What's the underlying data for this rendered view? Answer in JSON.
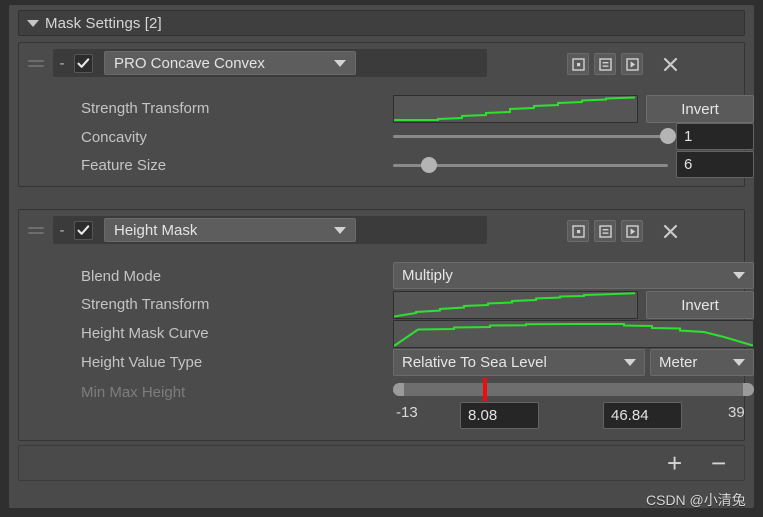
{
  "window": {
    "background": "#2f2f2f"
  },
  "foldout": {
    "title": "Mask Settings [2]",
    "arrow_icon": "triangle-down-icon"
  },
  "colors": {
    "curve_line": "#2ee02e",
    "marker_red": "#f00a0a",
    "panel": "#4b4b4b",
    "field_dark": "#262626",
    "text": "#c4c4c4"
  },
  "modules": [
    {
      "id": "pro-concave-convex",
      "collapse_label": "-",
      "enabled": true,
      "name": "PRO Concave Convex",
      "header_buttons": [
        "preset-icon",
        "list-icon",
        "play-icon"
      ],
      "close_label": "✕",
      "rows": [
        {
          "label": "Strength Transform",
          "type": "curve",
          "action_label": "Invert"
        },
        {
          "label": "Concavity",
          "type": "slider",
          "value": "1",
          "fill": 100
        },
        {
          "label": "Feature Size",
          "type": "slider",
          "value": "6",
          "fill": 13
        }
      ]
    },
    {
      "id": "height-mask",
      "collapse_label": "-",
      "enabled": true,
      "name": "Height Mask",
      "header_buttons": [
        "preset-icon",
        "list-icon",
        "play-icon"
      ],
      "close_label": "✕",
      "rows": [
        {
          "label": "Blend Mode",
          "type": "dropdown",
          "value": "Multiply"
        },
        {
          "label": "Strength Transform",
          "type": "curve",
          "action_label": "Invert"
        },
        {
          "label": "Height Mask Curve",
          "type": "curve"
        },
        {
          "label": "Height Value Type",
          "type": "dropdown2",
          "value": "Relative To Sea Level",
          "unit": "Meter"
        },
        {
          "label": "Min Max Height",
          "type": "minmax",
          "disabled": true,
          "range_min": "-13",
          "range_max": "39",
          "value_min": "8.08",
          "value_max": "46.84",
          "marker_pct": 25
        }
      ]
    }
  ],
  "footer": {
    "add_label": "+",
    "remove_label": "−"
  },
  "watermark": {
    "text": "CSDN @小清兔"
  },
  "chart_data": [
    {
      "type": "line",
      "title": "Strength Transform (PRO Concave Convex)",
      "x": [
        0,
        0.18,
        0.28,
        0.38,
        0.5,
        0.62,
        0.72,
        0.84,
        1
      ],
      "y": [
        0.05,
        0.05,
        0.12,
        0.2,
        0.31,
        0.45,
        0.58,
        0.75,
        0.95
      ],
      "xlabel": "",
      "ylabel": "",
      "ylim": [
        0,
        1
      ],
      "grid": false
    },
    {
      "type": "line",
      "title": "Strength Transform (Height Mask)",
      "x": [
        0,
        0.12,
        0.25,
        0.4,
        0.55,
        0.7,
        0.85,
        1
      ],
      "y": [
        0.05,
        0.2,
        0.32,
        0.45,
        0.56,
        0.68,
        0.8,
        0.95
      ],
      "xlabel": "",
      "ylabel": "",
      "ylim": [
        0,
        1
      ],
      "grid": false
    },
    {
      "type": "line",
      "title": "Height Mask Curve",
      "x": [
        0,
        0.06,
        0.12,
        0.28,
        0.45,
        0.6,
        0.72,
        0.85,
        0.94,
        1
      ],
      "y": [
        0.02,
        0.68,
        0.74,
        0.82,
        0.9,
        0.9,
        0.78,
        0.6,
        0.28,
        0.05
      ],
      "xlabel": "",
      "ylabel": "",
      "ylim": [
        0,
        1
      ],
      "grid": false
    }
  ]
}
